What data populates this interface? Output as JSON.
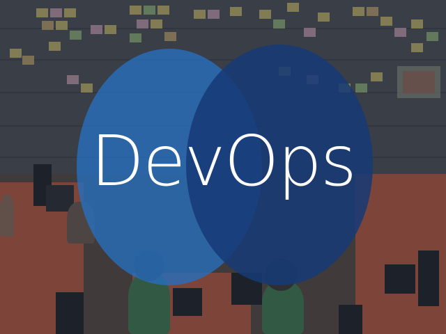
{
  "title": "DevOps",
  "colors": {
    "left_circle": "#2b6fb8",
    "right_circle": "#173b78",
    "text": "#ffffff"
  }
}
